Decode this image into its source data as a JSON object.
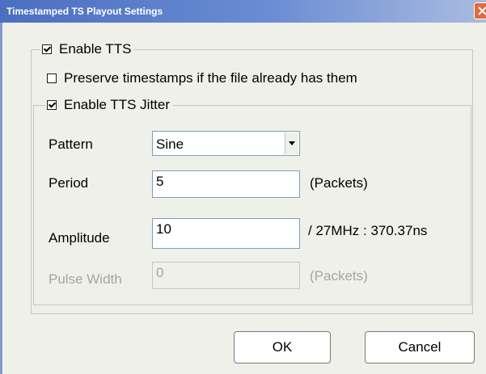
{
  "window": {
    "title": "Timestamped TS Playout Settings"
  },
  "enable_tts": {
    "label": "Enable TTS",
    "checked": true
  },
  "preserve_timestamps": {
    "label": "Preserve timestamps if the file already has them",
    "checked": false
  },
  "enable_jitter": {
    "label": "Enable TTS Jitter",
    "checked": true
  },
  "pattern": {
    "label": "Pattern",
    "value": "Sine"
  },
  "period": {
    "label": "Period",
    "value": "5",
    "unit": "(Packets)"
  },
  "amplitude": {
    "label": "Amplitude",
    "value": "10",
    "unit": "/ 27MHz :  370.37ns"
  },
  "pulse_width": {
    "label": "Pulse Width",
    "value": "0",
    "unit": "(Packets)",
    "disabled": true
  },
  "buttons": {
    "ok": "OK",
    "cancel": "Cancel"
  },
  "colors": {
    "title_bar_start": "#4a6fc0",
    "title_bar_end": "#a9bbdf",
    "close_button": "#e3693f",
    "dialog_bg": "#f0f0ea",
    "disabled_text": "#a6a69e"
  },
  "icons": {
    "close": "close-icon",
    "dropdown": "chevron-down-icon",
    "checkbox": "checkbox-icon"
  }
}
